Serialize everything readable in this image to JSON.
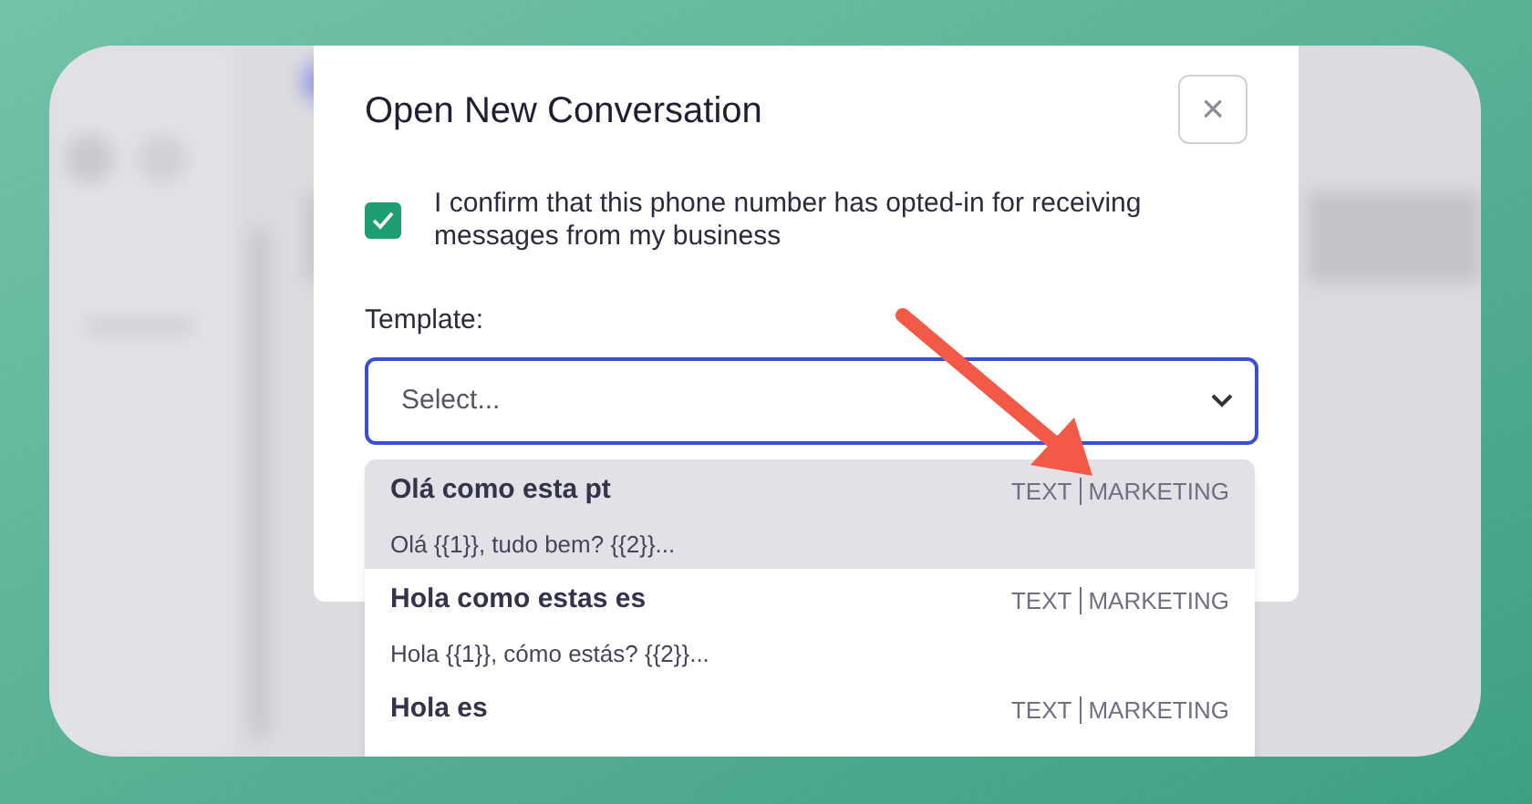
{
  "dialog": {
    "title": "Open New Conversation",
    "close": "×"
  },
  "consent": {
    "checked": true,
    "label": "I confirm that this phone number has opted-in for receiving messages from my business"
  },
  "template": {
    "label": "Template:",
    "placeholder": "Select..."
  },
  "options": [
    {
      "name": "Olá como esta pt",
      "preview": "Olá {{1}}, tudo bem? {{2}}...",
      "type": "TEXT",
      "category": "MARKETING",
      "selected": true
    },
    {
      "name": "Hola como estas es",
      "preview": "Hola {{1}}, cómo estás? {{2}}...",
      "type": "TEXT",
      "category": "MARKETING",
      "selected": false
    },
    {
      "name": "Hola es",
      "type": "TEXT",
      "category": "MARKETING",
      "selected": false
    }
  ]
}
